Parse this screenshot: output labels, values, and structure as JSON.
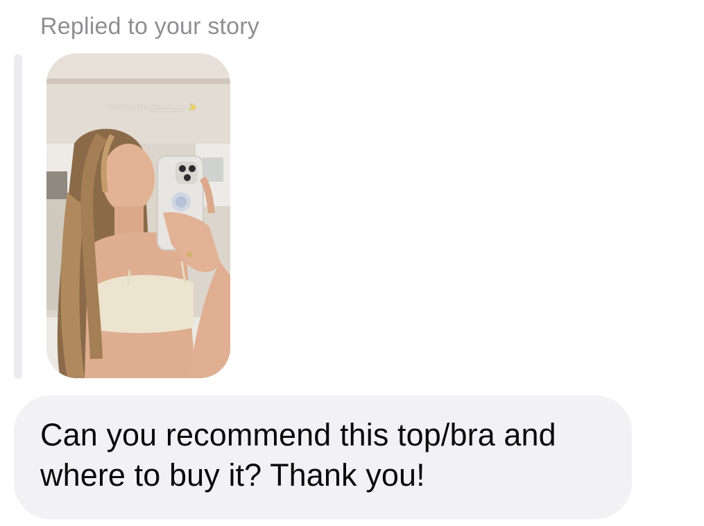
{
  "reply": {
    "label": "Replied to your story"
  },
  "story": {
    "caption_text": "Glowing skin",
    "caption_mention": "@santi_spa",
    "caption_sparkle": "✨"
  },
  "message": {
    "text": "Can you recommend this top/bra and where to buy it? Thank you!"
  },
  "colors": {
    "label_gray": "#8e8e93",
    "bubble_bg": "#f2f2f4",
    "quote_bar": "#ececee",
    "text": "#0a0a0a"
  }
}
